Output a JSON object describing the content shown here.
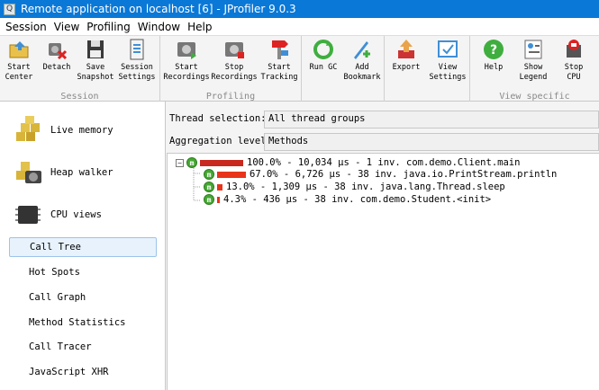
{
  "window": {
    "title": "Remote application on localhost [6] - JProfiler 9.0.3"
  },
  "menu": [
    "Session",
    "View",
    "Profiling",
    "Window",
    "Help"
  ],
  "toolbar": {
    "groups": [
      {
        "label": "Session",
        "buttons": [
          {
            "label": "Start\nCenter",
            "icon": "start-center-icon"
          },
          {
            "label": "Detach",
            "icon": "detach-icon"
          },
          {
            "label": "Save\nSnapshot",
            "icon": "save-snapshot-icon"
          },
          {
            "label": "Session\nSettings",
            "icon": "session-settings-icon"
          }
        ]
      },
      {
        "label": "Profiling",
        "buttons": [
          {
            "label": "Start\nRecordings",
            "icon": "start-recordings-icon"
          },
          {
            "label": "Stop\nRecordings",
            "icon": "stop-recordings-icon"
          },
          {
            "label": "Start\nTracking",
            "icon": "start-tracking-icon"
          }
        ]
      },
      {
        "label": "",
        "buttons": [
          {
            "label": "Run GC",
            "icon": "run-gc-icon"
          },
          {
            "label": "Add\nBookmark",
            "icon": "add-bookmark-icon"
          }
        ]
      },
      {
        "label": "",
        "buttons": [
          {
            "label": "Export",
            "icon": "export-icon"
          },
          {
            "label": "View\nSettings",
            "icon": "view-settings-icon"
          }
        ]
      },
      {
        "label": "View specific",
        "buttons": [
          {
            "label": "Help",
            "icon": "help-icon"
          },
          {
            "label": "Show\nLegend",
            "icon": "show-legend-icon"
          },
          {
            "label": "Stop\nCPU",
            "icon": "stop-cpu-icon"
          }
        ]
      }
    ]
  },
  "sidebar": {
    "sections": [
      {
        "label": "Live memory",
        "icon": "live-memory-icon"
      },
      {
        "label": "Heap walker",
        "icon": "heap-walker-icon"
      },
      {
        "label": "CPU views",
        "icon": "cpu-views-icon"
      }
    ],
    "items": [
      {
        "label": "Call Tree",
        "selected": true
      },
      {
        "label": "Hot Spots"
      },
      {
        "label": "Call Graph"
      },
      {
        "label": "Method Statistics"
      },
      {
        "label": "Call Tracer"
      },
      {
        "label": "JavaScript XHR"
      }
    ]
  },
  "controls": {
    "thread_selection_label": "Thread selection:",
    "thread_selection_value": "All thread groups",
    "aggregation_label": "Aggregation level:",
    "aggregation_value": "Methods"
  },
  "call_tree": [
    {
      "text": "100.0% - 10,034 µs - 1 inv. com.demo.Client.main",
      "percent": 100.0,
      "expander": "−"
    },
    {
      "text": "67.0% - 6,726 µs - 38 inv. java.io.PrintStream.println",
      "percent": 67.0
    },
    {
      "text": "13.0% - 1,309 µs - 38 inv. java.lang.Thread.sleep",
      "percent": 13.0
    },
    {
      "text": "4.3% - 436 µs - 38 inv. com.demo.Student.<init>",
      "percent": 4.3
    }
  ]
}
